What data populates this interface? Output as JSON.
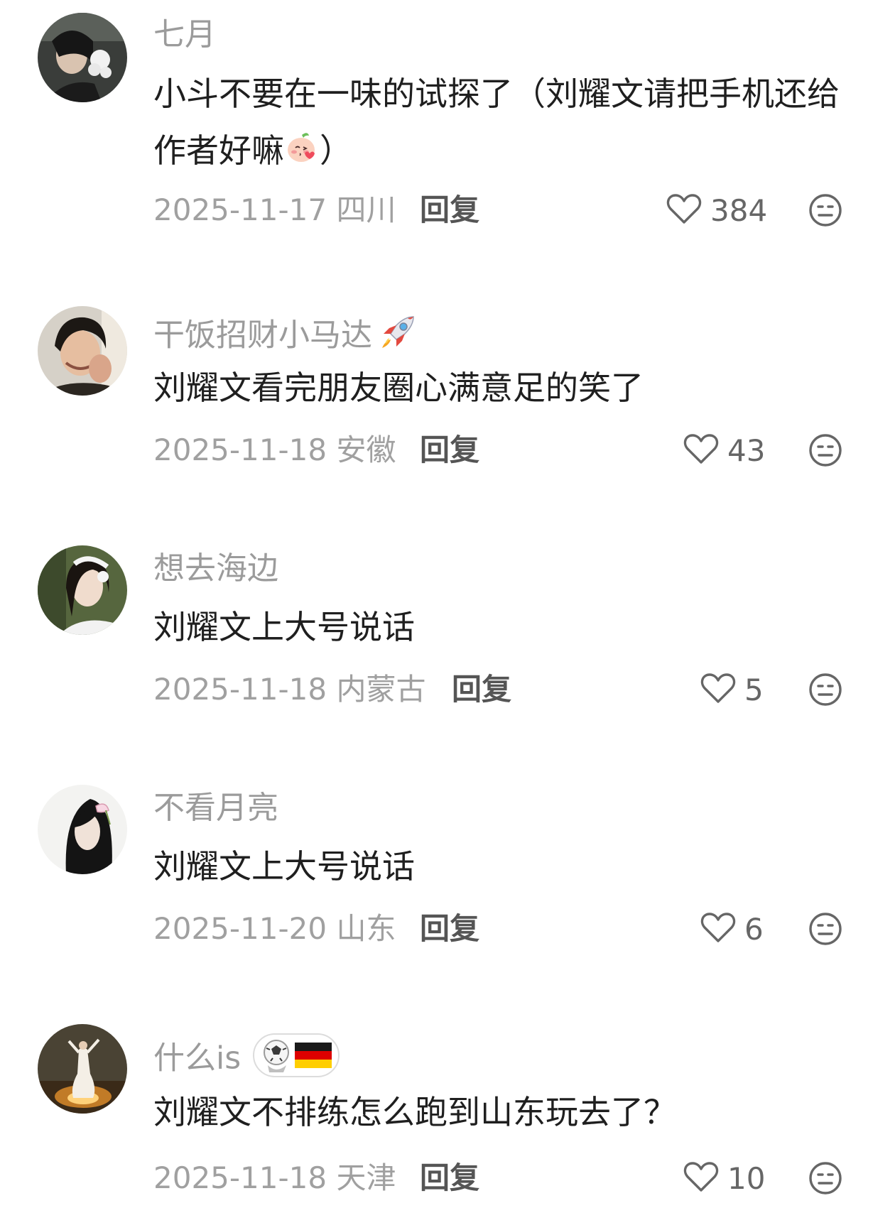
{
  "comments": [
    {
      "username": "七月",
      "content_a": "小斗不要在一味的试探了（刘耀文请把手机还给作者好嘛",
      "content_b": "）",
      "date": "2025-11-17",
      "location": "四川",
      "reply_label": "回复",
      "likes": "384"
    },
    {
      "username": "干饭招财小马达",
      "content": "刘耀文看完朋友圈心满意足的笑了",
      "date": "2025-11-18",
      "location": "安徽",
      "reply_label": "回复",
      "likes": "43"
    },
    {
      "username": "想去海边",
      "content": "刘耀文上大号说话",
      "date": "2025-11-18",
      "location": "内蒙古",
      "reply_label": "回复",
      "likes": "5"
    },
    {
      "username": "不看月亮",
      "content": "刘耀文上大号说话",
      "date": "2025-11-20",
      "location": "山东",
      "reply_label": "回复",
      "likes": "6"
    },
    {
      "username": "什么is",
      "content": "刘耀文不排练怎么跑到山东玩去了？",
      "date": "2025-11-18",
      "location": "天津",
      "reply_label": "回复",
      "likes": "10"
    }
  ],
  "icons": {
    "like": "heart-outline-icon",
    "dislike": "neutral-face-icon"
  },
  "colors": {
    "username": "#9b9b9b",
    "content": "#1f1f1f",
    "meta": "#a0a0a0",
    "reply": "#555555"
  }
}
